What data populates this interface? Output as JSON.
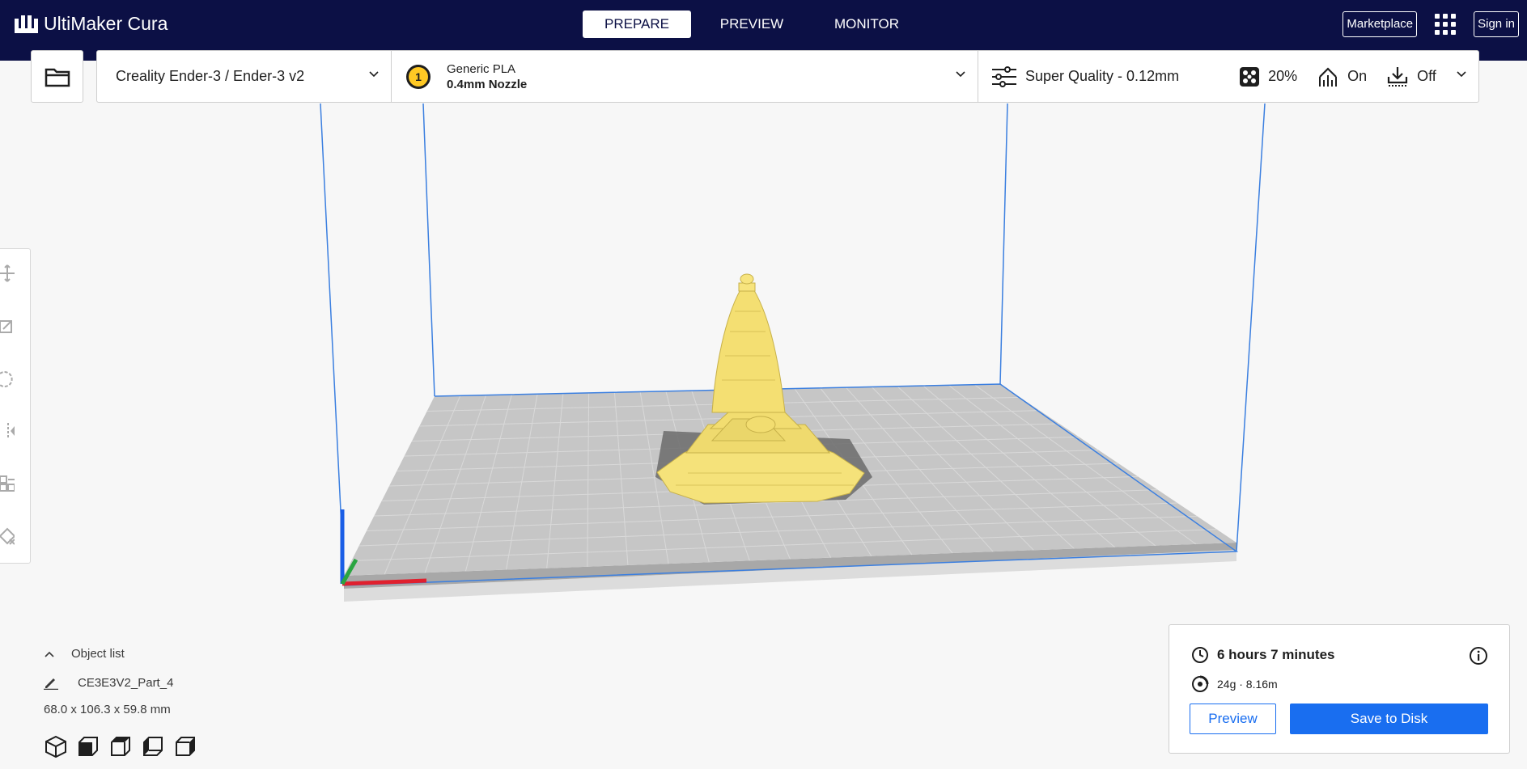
{
  "app": {
    "title": "UltiMaker Cura"
  },
  "stages": [
    {
      "label": "PREPARE",
      "active": true
    },
    {
      "label": "PREVIEW",
      "active": false
    },
    {
      "label": "MONITOR",
      "active": false
    }
  ],
  "header": {
    "marketplace_label": "Marketplace",
    "signin_label": "Sign in"
  },
  "printer": {
    "name": "Creality Ender-3 / Ender-3 v2"
  },
  "material": {
    "extruder_number": "1",
    "name": "Generic PLA",
    "nozzle": "0.4mm Nozzle",
    "color": "#ffc924"
  },
  "settings": {
    "profile": "Super Quality - 0.12mm",
    "infill": "20%",
    "support": "On",
    "adhesion": "Off"
  },
  "object_list": {
    "header": "Object list",
    "object_name": "CE3E3V2_Part_4",
    "dimensions": "68.0 x 106.3 x 59.8 mm"
  },
  "print_info": {
    "time": "6 hours 7 minutes",
    "material_usage": "24g · 8.16m",
    "preview_label": "Preview",
    "save_label": "Save to Disk"
  },
  "colors": {
    "header_bg": "#0c1045",
    "accent_blue": "#196ef0",
    "model_yellow": "#f5e27a",
    "build_plate": "#c8c8c8"
  }
}
